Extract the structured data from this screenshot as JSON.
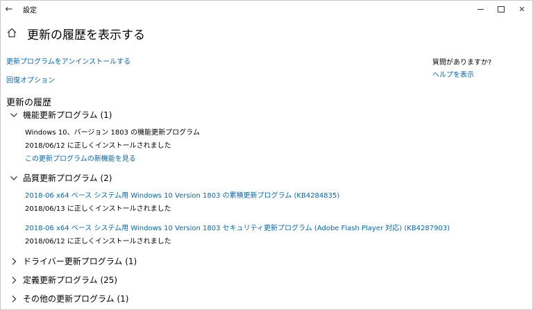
{
  "window": {
    "title": "設定",
    "back_glyph": "←",
    "close_glyph": "✕"
  },
  "header": {
    "title": "更新の履歴を表示する"
  },
  "links": {
    "uninstall": "更新プログラムをアンインストールする",
    "recovery": "回復オプション"
  },
  "side": {
    "question": "質問がありますか?",
    "help_link": "ヘルプを表示"
  },
  "history": {
    "title": "更新の履歴",
    "feature": {
      "label": "機能更新プログラム (1)",
      "items": [
        {
          "name": "Windows 10、バージョン 1803 の機能更新プログラム",
          "status": "2018/06/12 に正しくインストールされました",
          "link": "この更新プログラムの新機能を見る"
        }
      ]
    },
    "quality": {
      "label": "品質更新プログラム (2)",
      "items": [
        {
          "name": "2018-06 x64 ベース システム用 Windows 10 Version 1803 の累積更新プログラム (KB4284835)",
          "status": "2018/06/13 に正しくインストールされました"
        },
        {
          "name": "2018-06 x64 ベース システム用 Windows 10 Version 1803 セキュリティ更新プログラム (Adobe Flash Player 対応) (KB4287903)",
          "status": "2018/06/12 に正しくインストールされました"
        }
      ]
    },
    "driver": {
      "label": "ドライバー更新プログラム (1)"
    },
    "definition": {
      "label": "定義更新プログラム (25)"
    },
    "other": {
      "label": "その他の更新プログラム (1)"
    }
  },
  "colors": {
    "link": "#0067b8",
    "text": "#000000",
    "background": "#ffffff"
  },
  "icons": {
    "back": "back-arrow-icon",
    "home": "home-icon",
    "minimize": "minimize-icon",
    "maximize": "maximize-icon",
    "close": "close-icon",
    "expanded": "chevron-down-icon",
    "collapsed": "chevron-right-icon"
  }
}
